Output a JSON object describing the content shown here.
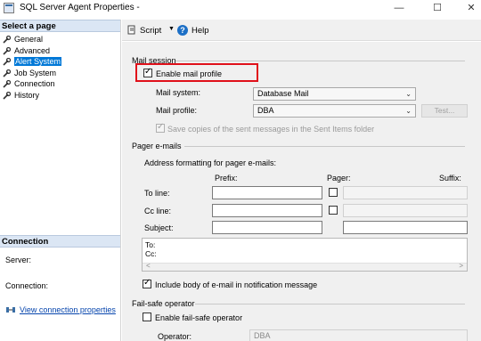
{
  "window": {
    "title": "SQL Server Agent Properties -",
    "minimize": "—",
    "maximize": "☐",
    "close": "✕"
  },
  "left_pane": {
    "select_page_header": "Select a page",
    "pages": [
      {
        "label": "General"
      },
      {
        "label": "Advanced"
      },
      {
        "label": "Alert System",
        "selected": true
      },
      {
        "label": "Job System"
      },
      {
        "label": "Connection"
      },
      {
        "label": "History"
      }
    ],
    "connection_header": "Connection",
    "server_label": "Server:",
    "connection_label": "Connection:",
    "view_connection_link": "View connection properties"
  },
  "toolbar": {
    "script_label": "Script",
    "script_dropdown_arrow": "▼",
    "help_icon_glyph": "?",
    "help_label": "Help"
  },
  "mail_session": {
    "title": "Mail session",
    "enable_mail_profile_label": "Enable mail profile",
    "enable_mail_profile_checked": true,
    "mail_system_label": "Mail system:",
    "mail_system_value": "Database Mail",
    "mail_profile_label": "Mail profile:",
    "mail_profile_value": "DBA",
    "test_button_label": "Test...",
    "save_copies_label": "Save copies of the sent messages in the Sent Items folder",
    "save_copies_checked": true,
    "highlight_color": "#e0101a"
  },
  "pager": {
    "title": "Pager e-mails",
    "address_formatting_label": "Address formatting for pager e-mails:",
    "prefix_header": "Prefix:",
    "pager_header": "Pager:",
    "suffix_header": "Suffix:",
    "to_line_label": "To line:",
    "cc_line_label": "Cc line:",
    "subject_label": "Subject:",
    "preview_to": "To:",
    "preview_cc": "Cc:",
    "scroll_left": "<",
    "scroll_right": ">",
    "include_body_label": "Include body of e-mail in notification message",
    "include_body_checked": true
  },
  "failsafe": {
    "title": "Fail-safe operator",
    "enable_label": "Enable fail-safe operator",
    "enable_checked": false,
    "operator_label": "Operator:",
    "operator_value": "DBA"
  },
  "colors": {
    "selected_page": "#0078d7",
    "link": "#0645ad"
  }
}
